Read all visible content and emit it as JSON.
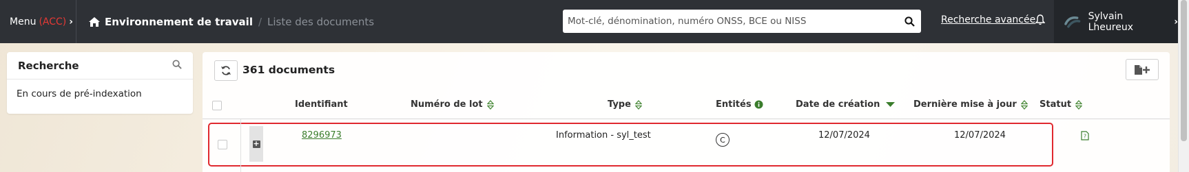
{
  "topbar": {
    "menu_label": "Menu",
    "menu_env": "(ACC)",
    "breadcrumb_current": "Environnement de travail",
    "breadcrumb_separator": "/",
    "breadcrumb_page": "Liste des documents",
    "search_placeholder": "Mot-clé, dénomination, numéro ONSS, BCE ou NISS",
    "advanced_search": "Recherche avancée",
    "user_name": "Sylvain Lheureux"
  },
  "sidebar": {
    "title": "Recherche",
    "status_text": "En cours de pré-indexation"
  },
  "documents": {
    "count_label": "361 documents",
    "columns": [
      "Identifiant",
      "Numéro de lot",
      "Type",
      "Entités",
      "Date de création",
      "Dernière mise à jour",
      "Statut"
    ],
    "rows": [
      {
        "id": "8296973",
        "lot": "",
        "type": "Information - syl_test",
        "entity": "C",
        "created": "12/07/2024",
        "updated": "12/07/2024",
        "status_icon": "document-question-icon"
      }
    ]
  },
  "colors": {
    "topbar": "#2e3136",
    "accent_green": "#3a7d2c",
    "highlight_red": "#e0282e",
    "env_red": "#e53935"
  }
}
